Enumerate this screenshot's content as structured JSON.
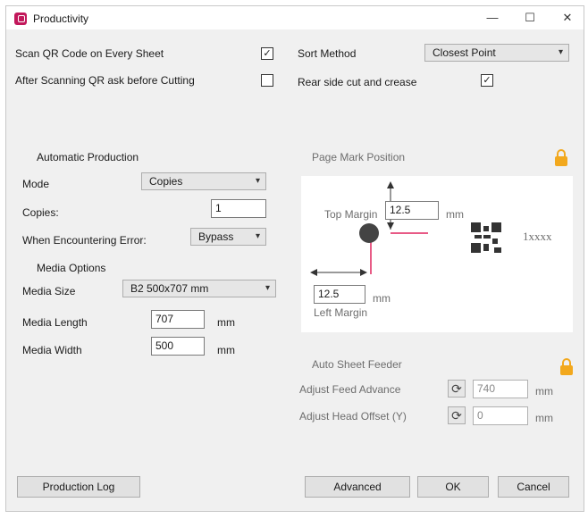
{
  "window": {
    "title": "Productivity",
    "minimize": "—",
    "maximize": "☐",
    "close": "✕"
  },
  "scan_qr": {
    "label": "Scan QR Code on Every Sheet",
    "checked": "✓"
  },
  "after_scan": {
    "label": "After Scanning QR ask before Cutting",
    "checked": ""
  },
  "sort_method": {
    "label": "Sort Method",
    "value": "Closest Point"
  },
  "rear_side": {
    "label": "Rear side cut and crease",
    "checked": "✓"
  },
  "automatic_production": {
    "heading": "Automatic Production",
    "mode_label": "Mode",
    "mode_value": "Copies",
    "copies_label": "Copies:",
    "copies_value": "1",
    "error_label": "When Encountering Error:",
    "error_value": "Bypass"
  },
  "media_options": {
    "heading": "Media Options",
    "size_label": "Media Size",
    "size_value": "B2 500x707 mm",
    "length_label": "Media Length",
    "length_value": "707",
    "width_label": "Media Width",
    "width_value": "500",
    "unit": "mm"
  },
  "page_mark": {
    "heading": "Page Mark Position",
    "top_margin_label": "Top Margin",
    "top_margin_value": "12.5",
    "left_margin_label": "Left Margin",
    "left_margin_value": "12.5",
    "unit": "mm",
    "sample_text": "1xxxx"
  },
  "auto_sheet_feeder": {
    "heading": "Auto Sheet Feeder",
    "feed_label": "Adjust Feed Advance",
    "feed_value": "740",
    "head_label": "Adjust Head Offset (Y)",
    "head_value": "0",
    "unit": "mm"
  },
  "buttons": {
    "production_log": "Production Log",
    "advanced": "Advanced",
    "ok": "OK",
    "cancel": "Cancel"
  },
  "colors": {
    "lock": "#f2a81d",
    "marker_line": "#e0245e",
    "app_icon": "#c2185b"
  }
}
